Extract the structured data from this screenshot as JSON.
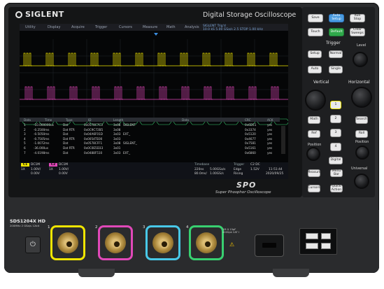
{
  "brand": {
    "logo": "SIGLENT",
    "title": "Digital Storage Oscilloscope"
  },
  "menu": [
    "Utility",
    "Display",
    "Acquire",
    "Trigger",
    "Cursors",
    "Measure",
    "Math",
    "Analysis"
  ],
  "status_readout": {
    "line1": "SIGLENT  Trig'd",
    "line2": "10.0 kS 5.00 GSa/s   2.5 STOP  1.00 kHz"
  },
  "decode_table": {
    "headers": [
      "Data",
      "Time",
      "Type",
      "ID",
      "Length",
      "",
      "Data",
      "",
      "CRC",
      "ACK"
    ],
    "rows": [
      {
        "n": "1",
        "time": "-10.000000us",
        "type": "Dat",
        "id": "0x0578C7C3",
        "len": "3x08",
        "data": "SIGLENT",
        "crc": "0x6D51",
        "ack": "yes"
      },
      {
        "n": "2",
        "time": "-0.2500ms",
        "type": "Dat RTR",
        "id": "0x0C9C72B5",
        "len": "3x08",
        "data": "",
        "crc": "0x3374",
        "ack": "yes"
      },
      {
        "n": "3",
        "time": "-0.5050ms",
        "type": "Dat",
        "id": "0x04A6F01D",
        "len": "3x03",
        "data": "EXT_",
        "crc": "0x5120",
        "ack": "yes"
      },
      {
        "n": "4",
        "time": "-0.7505ms",
        "type": "Dat RTR",
        "id": "0x0054TE00",
        "len": "3x03",
        "data": "",
        "crc": "0x4677",
        "ack": "yes"
      },
      {
        "n": "5",
        "time": "-1.0072ms",
        "type": "Dat",
        "id": "0x0578CFF1",
        "len": "3x08",
        "data": "SIGLENT_",
        "crc": "0x7581",
        "ack": "yes"
      },
      {
        "n": "6",
        "time": "-36.000us",
        "type": "Dat RTR",
        "id": "0x0C0E5D33",
        "len": "3x01",
        "data": "",
        "crc": "0x5161",
        "ack": "yes"
      },
      {
        "n": "7",
        "time": "-4.0198ms",
        "type": "Dat",
        "id": "0x0488F510",
        "len": "3x03",
        "data": "EXT_",
        "crc": "0x6860",
        "ack": "yes"
      }
    ]
  },
  "bottom_bar": {
    "ch1": {
      "tag": "C1",
      "coupling": "DC1M",
      "scale": "1.00V/",
      "offset": "0.00V",
      "extra": "1X"
    },
    "ch2": {
      "tag": "C2",
      "coupling": "DC1M",
      "scale": "1.00V/",
      "offset": "0.00V",
      "extra": "1X"
    },
    "timebase": {
      "label": "Timebase",
      "delay": "220ns",
      "rate": "5.00GSa/s",
      "scale": "80.0ms/",
      "points": "1.00GS/s"
    },
    "trigger": {
      "label": "Trigger",
      "edge": "Edge",
      "type": "Rising",
      "source": "C2 DC",
      "level": "1.52V"
    },
    "clock": {
      "time": "11:51:44",
      "date": "2020/09/25"
    }
  },
  "panel": {
    "top_buttons": [
      "Save",
      "Auto Setup",
      "Run Stop",
      "Touch",
      "Default",
      "Clear Sweeps"
    ],
    "trigger_title": "Trigger",
    "trigger_buttons": [
      "Setup",
      "Normal",
      "Auto",
      "Single"
    ],
    "level_label": "Level",
    "vertical_title": "Vertical",
    "horizontal_title": "Horizontal",
    "channel_buttons": [
      "1",
      "2",
      "3",
      "4"
    ],
    "side_buttons": [
      "Math",
      "Ref",
      "Digital",
      "Roll",
      "Search"
    ],
    "position_label": "Position",
    "universal_label": "Universal",
    "bottom_buttons": [
      "Measure",
      "Menu Bar",
      "Cursors",
      "Quick Action"
    ]
  },
  "logo_spo": "SPO",
  "spo_tagline": "Super Phosphor Oscilloscope",
  "front": {
    "model": "SDS1204X HD",
    "model_sub": "200MHz  2 GSa/s  12bit",
    "channels": [
      "1",
      "2",
      "3",
      "4"
    ],
    "warning": "1M Ω 15pF 400Vpk CAT I"
  },
  "colors": {
    "ch1": "#f0e500",
    "ch2": "#e048b8",
    "ch3": "#48c8e8",
    "ch4": "#38d070"
  },
  "icons": [
    "power-icon",
    "hdmi-port-icon",
    "usb-port-icon",
    "warning-icon"
  ]
}
